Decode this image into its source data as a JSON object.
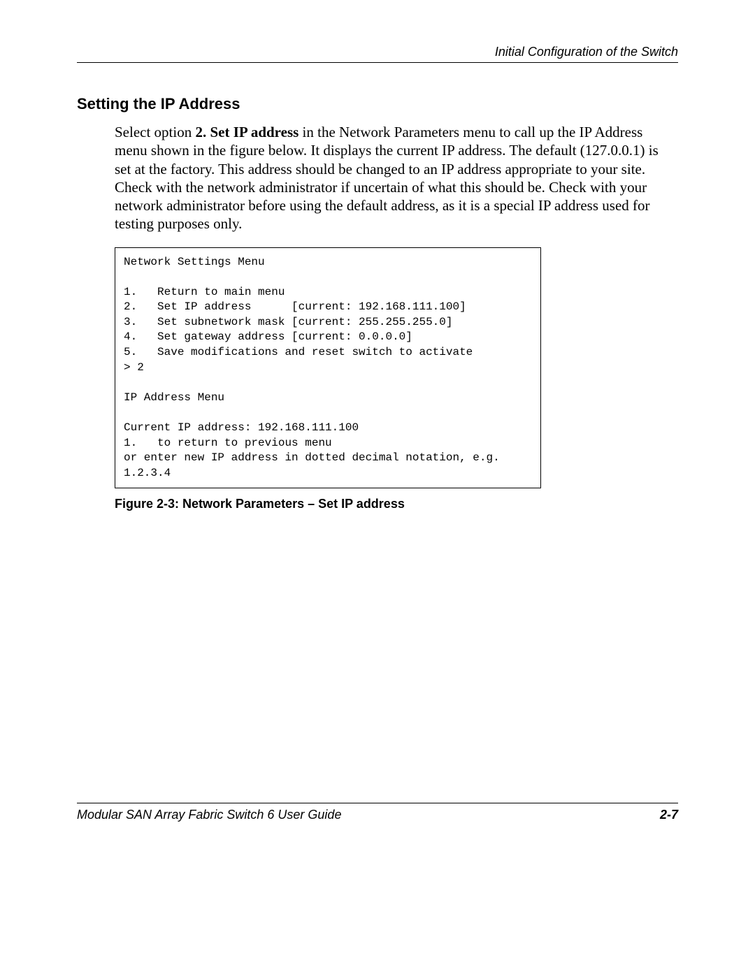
{
  "header": {
    "running_title": "Initial Configuration of the Switch"
  },
  "section": {
    "heading": "Setting the IP Address",
    "para_prefix": "Select option ",
    "para_bold": "2. Set IP address",
    "para_suffix": " in the Network Parameters menu to call up the IP Address menu shown in the figure below. It displays the current IP address. The default (127.0.0.1) is set at the factory. This address should be changed to an IP address appropriate to your site. Check with the network administrator if uncertain of what this should be. Check with your network administrator before using the default address, as it is a special IP address used for testing purposes only."
  },
  "terminal": {
    "text": "Network Settings Menu\n\n1.   Return to main menu\n2.   Set IP address      [current: 192.168.111.100]\n3.   Set subnetwork mask [current: 255.255.255.0]\n4.   Set gateway address [current: 0.0.0.0]\n5.   Save modifications and reset switch to activate\n> 2\n\nIP Address Menu\n\nCurrent IP address: 192.168.111.100\n1.   to return to previous menu\nor enter new IP address in dotted decimal notation, e.g.\n1.2.3.4"
  },
  "figure": {
    "caption": "Figure 2-3:  Network Parameters – Set IP address"
  },
  "footer": {
    "doc_title": "Modular SAN Array Fabric Switch 6 User Guide",
    "page_number": "2-7"
  }
}
